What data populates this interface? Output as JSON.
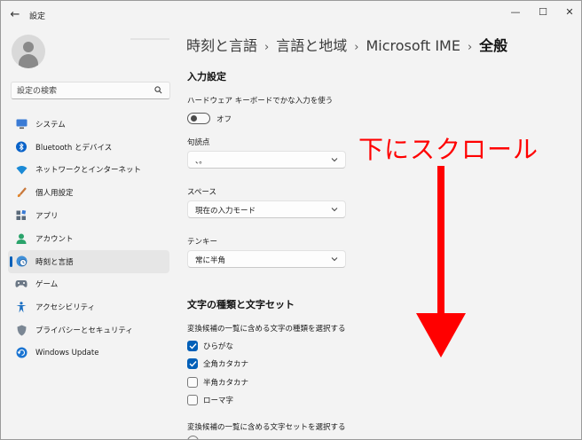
{
  "window": {
    "title": "設定",
    "controls": {
      "minimize": "—",
      "maximize": "☐",
      "close": "✕"
    }
  },
  "sidebar": {
    "search_placeholder": "設定の検索",
    "items": [
      {
        "label": "システム",
        "icon": "monitor-icon",
        "selected": false
      },
      {
        "label": "Bluetooth とデバイス",
        "icon": "bluetooth-icon",
        "selected": false
      },
      {
        "label": "ネットワークとインターネット",
        "icon": "wifi-icon",
        "selected": false
      },
      {
        "label": "個人用設定",
        "icon": "brush-icon",
        "selected": false
      },
      {
        "label": "アプリ",
        "icon": "apps-icon",
        "selected": false
      },
      {
        "label": "アカウント",
        "icon": "account-icon",
        "selected": false
      },
      {
        "label": "時刻と言語",
        "icon": "globe-clock-icon",
        "selected": true
      },
      {
        "label": "ゲーム",
        "icon": "gamepad-icon",
        "selected": false
      },
      {
        "label": "アクセシビリティ",
        "icon": "accessibility-icon",
        "selected": false
      },
      {
        "label": "プライバシーとセキュリティ",
        "icon": "shield-icon",
        "selected": false
      },
      {
        "label": "Windows Update",
        "icon": "update-icon",
        "selected": false
      }
    ]
  },
  "breadcrumb": {
    "items": [
      "時刻と言語",
      "言語と地域",
      "Microsoft IME"
    ],
    "current": "全般",
    "separator": "›"
  },
  "input_settings": {
    "title": "入力設定",
    "hardware_kana_label": "ハードウェア キーボードでかな入力を使う",
    "hardware_kana_toggle": "オフ",
    "punctuation_label": "句読点",
    "punctuation_value": "、。",
    "space_label": "スペース",
    "space_value": "現在の入力モード",
    "numpad_label": "テンキー",
    "numpad_value": "常に半角"
  },
  "char_settings": {
    "title": "文字の種類と文字セット",
    "types_label": "変換候補の一覧に含める文字の種類を選択する",
    "types": [
      {
        "label": "ひらがな",
        "checked": true
      },
      {
        "label": "全角カタカナ",
        "checked": true
      },
      {
        "label": "半角カタカナ",
        "checked": false
      },
      {
        "label": "ローマ字",
        "checked": false
      }
    ],
    "charset_label": "変換候補の一覧に含める文字セットを選択する"
  },
  "annotation": {
    "text": "下にスクロール",
    "color": "#ff0000"
  },
  "colors": {
    "accent": "#005fb8",
    "background": "#f3f3f3"
  }
}
